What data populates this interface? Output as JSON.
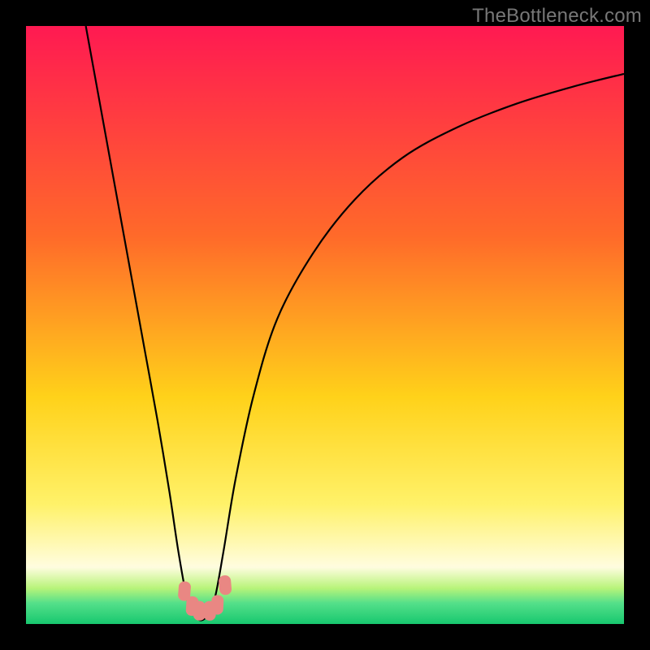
{
  "watermark": "TheBottleneck.com",
  "chart_data": {
    "type": "line",
    "title": "",
    "xlabel": "",
    "ylabel": "",
    "xlim": [
      0,
      100
    ],
    "ylim": [
      0,
      100
    ],
    "grid": false,
    "legend": false,
    "background_gradient": {
      "stops": [
        {
          "pos": 0.0,
          "color": "#ff1a52"
        },
        {
          "pos": 0.35,
          "color": "#ff6a2a"
        },
        {
          "pos": 0.62,
          "color": "#ffd21a"
        },
        {
          "pos": 0.8,
          "color": "#fff26a"
        },
        {
          "pos": 0.905,
          "color": "#fffde0"
        },
        {
          "pos": 0.94,
          "color": "#b9f47a"
        },
        {
          "pos": 0.965,
          "color": "#55e08a"
        },
        {
          "pos": 1.0,
          "color": "#18c86f"
        }
      ]
    },
    "series": [
      {
        "name": "bottleneck-curve",
        "color": "#000000",
        "x": [
          10,
          12,
          14,
          16,
          18,
          20,
          22,
          24,
          25.5,
          27,
          28.5,
          30,
          31.5,
          33,
          35,
          38,
          42,
          48,
          55,
          63,
          72,
          82,
          92,
          100
        ],
        "y": [
          100,
          89,
          78,
          67,
          56,
          45,
          34,
          22,
          12,
          4,
          1,
          1,
          4,
          12,
          24,
          38,
          51,
          62,
          71,
          78,
          83,
          87,
          90,
          92
        ]
      }
    ],
    "markers": [
      {
        "name": "trough-marker",
        "x": 26.5,
        "y": 5.5,
        "color": "#e98783"
      },
      {
        "name": "trough-marker",
        "x": 27.8,
        "y": 3.0,
        "color": "#e98783"
      },
      {
        "name": "trough-marker",
        "x": 29.0,
        "y": 2.2,
        "color": "#e98783"
      },
      {
        "name": "trough-marker",
        "x": 30.7,
        "y": 2.2,
        "color": "#e98783"
      },
      {
        "name": "trough-marker",
        "x": 32.0,
        "y": 3.2,
        "color": "#e98783"
      },
      {
        "name": "trough-marker",
        "x": 33.3,
        "y": 6.5,
        "color": "#e98783"
      }
    ]
  }
}
